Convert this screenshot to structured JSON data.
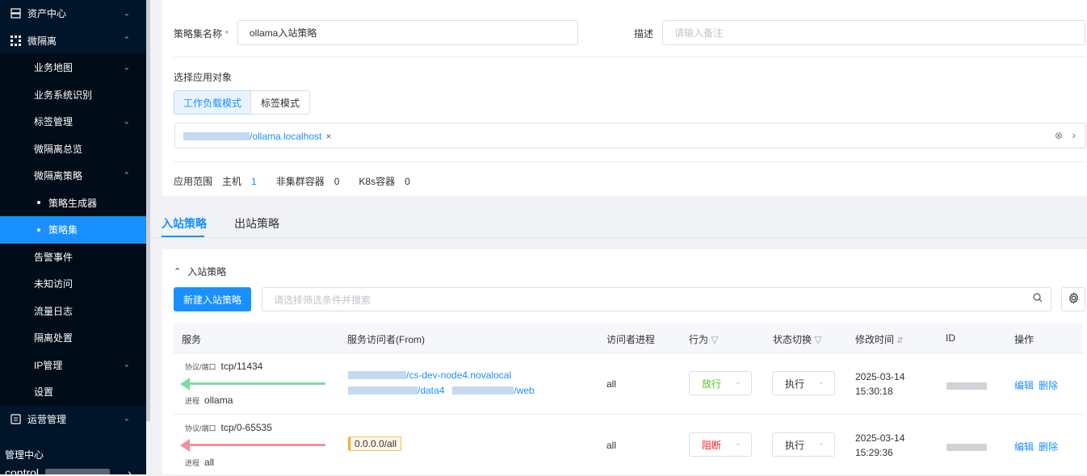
{
  "sidebar": {
    "items": [
      {
        "label": "资产中心"
      },
      {
        "label": "微隔离"
      },
      {
        "label": "业务地图"
      },
      {
        "label": "业务系统识别"
      },
      {
        "label": "标签管理"
      },
      {
        "label": "微隔离总览"
      },
      {
        "label": "微隔离策略"
      },
      {
        "label": "策略生成器"
      },
      {
        "label": "策略集"
      },
      {
        "label": "告警事件"
      },
      {
        "label": "未知访问"
      },
      {
        "label": "流量日志"
      },
      {
        "label": "隔离处置"
      },
      {
        "label": "IP管理"
      },
      {
        "label": "设置"
      },
      {
        "label": "运营管理"
      }
    ],
    "footer_title": "管理中心",
    "footer_user": "control"
  },
  "form": {
    "name_label": "策略集名称",
    "required_mark": "*",
    "name_value": "ollama入站策略",
    "desc_label": "描述",
    "desc_placeholder": "请输入备注",
    "target_label": "选择应用对象",
    "mode_workload": "工作负载模式",
    "mode_tag": "标签模式",
    "selected_tag": "/ollama.localhost",
    "tag_close": "×",
    "scope_label": "应用范围",
    "host_label": "主机",
    "host_count": "1",
    "noncluster_label": "非集群容器",
    "noncluster_count": "0",
    "k8s_label": "K8s容器",
    "k8s_count": "0"
  },
  "tabs": {
    "inbound": "入站策略",
    "outbound": "出站策略"
  },
  "section": {
    "title": "入站策略",
    "new_button": "新建入站策略",
    "search_placeholder": "请选择筛选条件并搜索"
  },
  "table": {
    "headers": {
      "service": "服务",
      "from": "服务访问者(From)",
      "process": "访问者进程",
      "action": "行为",
      "state": "状态切换",
      "modified": "修改时间",
      "id": "ID",
      "ops": "操作"
    },
    "port_label": "协议/端口",
    "proc_label": "进程",
    "edit": "编辑",
    "delete": "删除",
    "rows": [
      {
        "port": "tcp/11434",
        "proc": "ollama",
        "from1": "/cs-dev-node4.novalocal",
        "from2": "/data4",
        "from3": "/web",
        "visitor_proc": "all",
        "action": "放行",
        "state": "执行",
        "date": "2025-03-14",
        "time": "15:30:18"
      },
      {
        "port": "tcp/0-65535",
        "proc": "all",
        "from1": "0.0.0.0/all",
        "visitor_proc": "all",
        "action": "阻断",
        "state": "执行",
        "date": "2025-03-14",
        "time": "15:29:36"
      }
    ]
  },
  "colors": {
    "primary": "#1890ff",
    "sidebar_bg": "#001529",
    "allow_green": "#52c41a",
    "block_red": "#f5222d",
    "arrow_green": "#7ddba3",
    "arrow_red": "#f5909a"
  }
}
